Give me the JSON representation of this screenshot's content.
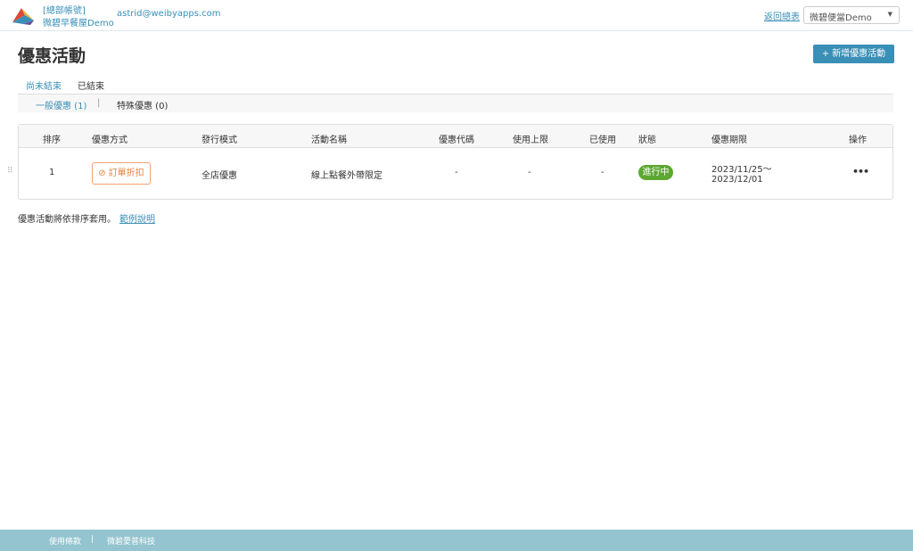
{
  "header": {
    "account_label": "[總部帳號]",
    "store_name": "微碧早餐屋Demo",
    "email": "astrid@weibyapps.com",
    "back_link": "返回總表",
    "store_select": "微碧便當Demo"
  },
  "page": {
    "title": "優惠活動",
    "new_button": "新增優惠活動"
  },
  "tabs": [
    {
      "label": "尚未結束",
      "active": true
    },
    {
      "label": "已結束",
      "active": false
    }
  ],
  "subtabs": [
    {
      "label": "一般優惠 (1)",
      "active": true
    },
    {
      "label": "特殊優惠 (0)",
      "active": false
    }
  ],
  "subtab_separator": "|",
  "table": {
    "headers": [
      "排序",
      "優惠方式",
      "發行模式",
      "活動名稱",
      "優惠代碼",
      "使用上限",
      "已使用",
      "狀態",
      "優惠期限",
      "操作"
    ],
    "rows": [
      {
        "order": "1",
        "type": "訂單折扣",
        "mode": "全店優惠",
        "name": "線上點餐外帶限定",
        "code": "-",
        "limit": "-",
        "used": "-",
        "status": "進行中",
        "period_start": "2023/11/25～",
        "period_end": "2023/12/01"
      }
    ]
  },
  "note": {
    "text": "優惠活動將依排序套用。",
    "link": "範例說明"
  },
  "footer": {
    "terms": "使用條款",
    "separator": "|",
    "company": "微碧愛普科技"
  },
  "colors": {
    "accent": "#3a8fb7",
    "status_active": "#5ca832",
    "tag_orange": "#e8833a",
    "footer_bg": "#93c4cf"
  }
}
